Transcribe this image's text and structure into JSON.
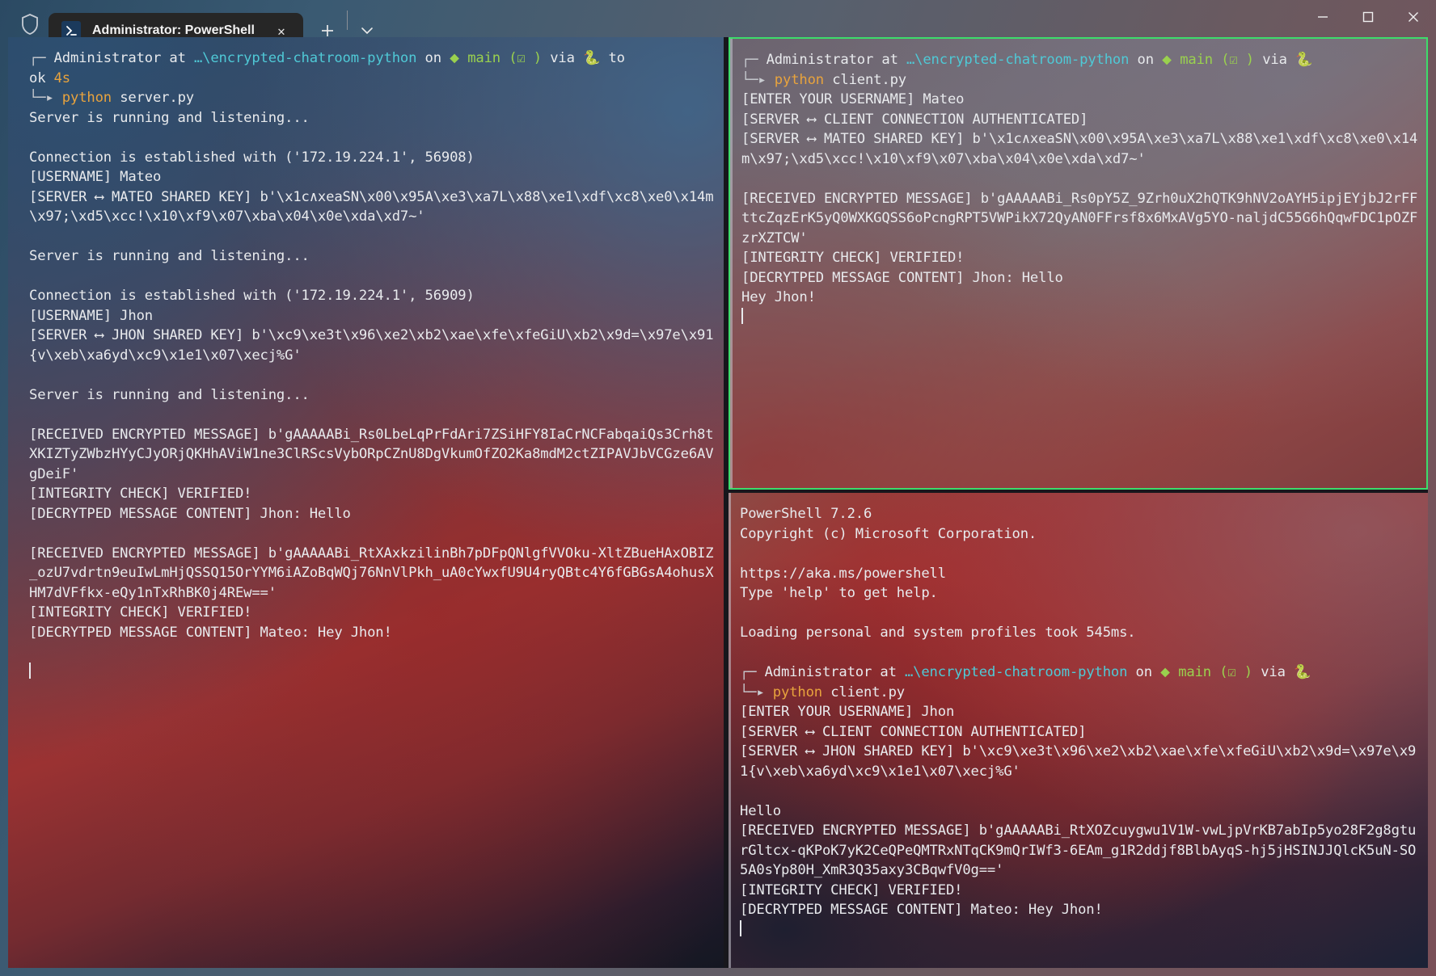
{
  "window": {
    "title": "Administrator: PowerShell",
    "controls": {
      "minimize": "─",
      "maximize": "□",
      "close": "✕"
    },
    "tab_close": "✕",
    "new_tab": "+",
    "dropdown": "⌄",
    "shield_icon": "shield-icon",
    "tab_icon_glyph": "〉_"
  },
  "colors": {
    "accent_green": "#3ddc6b",
    "prompt_cyan": "#4fc9d6",
    "branch_green": "#9ad14e",
    "cmd_yellow": "#e8a33d",
    "text": "#e8eaed"
  },
  "prompt": {
    "user": "Administrator",
    "at": "at",
    "path": "…\\encrypted-chatroom-python",
    "on": "on",
    "git_icon": "⬥",
    "branch": "main",
    "git_status": "(☑ )",
    "via": "via",
    "python_icon": "🐍",
    "took": "to",
    "ok": "ok",
    "duration": "4s",
    "arrow": "└─▸",
    "corner": "┌─"
  },
  "panes": {
    "left": {
      "name": "server-pane",
      "command_runner": "python",
      "command_arg": "server.py",
      "lines": [
        "Server is running and listening...",
        "",
        "Connection is established with ('172.19.224.1', 56908)",
        "[USERNAME] Mateo",
        "[SERVER ⟷ MATEO SHARED KEY] b'\\x1c∧xeaSN\\x00\\x95A\\xe3\\xa7L\\x88\\xe1\\xdf\\xc8\\xe0\\x14m\\x97;\\xd5\\xcc!\\x10\\xf9\\x07\\xba\\x04\\x0e\\xda\\xd7~'",
        "",
        "Server is running and listening...",
        "",
        "Connection is established with ('172.19.224.1', 56909)",
        "[USERNAME] Jhon",
        "[SERVER ⟷ JHON SHARED KEY] b'\\xc9\\xe3t\\x96\\xe2\\xb2\\xae\\xfe\\xfeGiU\\xb2\\x9d=\\x97e\\x91{v\\xeb\\xa6yd\\xc9\\x1e1\\x07\\xecj%G'",
        "",
        "Server is running and listening...",
        "",
        "[RECEIVED ENCRYPTED MESSAGE] b'gAAAAABi_Rs0LbeLqPrFdAri7ZSiHFY8IaCrNCFabqaiQs3Crh8tXKIZTyZWbzHYyCJyORjQKHhAViW1ne3ClRScsVybORpCZnU8DgVkumOfZO2Ka8mdM2ctZIPAVJbVCGze6AVgDeiF'",
        "[INTEGRITY CHECK] VERIFIED!",
        "[DECRYTPED MESSAGE CONTENT] Jhon: Hello",
        "",
        "[RECEIVED ENCRYPTED MESSAGE] b'gAAAAABi_RtXAxkzilinBh7pDFpQNlgfVVOku-XltZBueHAxOBIZ_ozU7vdrtn9euIwLmHjQSSQ15OrYYM6iAZoBqWQj76NnVlPkh_uA0cYwxfU9U4ryQBtc4Y6fGBGsA4ohusXHM7dVFfkx-eQy1nTxRhBK0j4REw=='",
        "[INTEGRITY CHECK] VERIFIED!",
        "[DECRYTPED MESSAGE CONTENT] Mateo: Hey Jhon!"
      ]
    },
    "right_top": {
      "name": "client-mateo-pane",
      "focused": true,
      "command_runner": "python",
      "command_arg": "client.py",
      "lines": [
        "[ENTER YOUR USERNAME] Mateo",
        "[SERVER ⟷ CLIENT CONNECTION AUTHENTICATED]",
        "[SERVER ⟷ MATEO SHARED KEY] b'\\x1c∧xeaSN\\x00\\x95A\\xe3\\xa7L\\x88\\xe1\\xdf\\xc8\\xe0\\x14m\\x97;\\xd5\\xcc!\\x10\\xf9\\x07\\xba\\x04\\x0e\\xda\\xd7~'",
        "",
        "[RECEIVED ENCRYPTED MESSAGE] b'gAAAAABi_Rs0pY5Z_9Zrh0uX2hQTK9hNV2oAYH5ipjEYjbJ2rFFttcZqzErK5yQ0WXKGQSS6oPcngRPT5VWPikX72QyAN0FFrsf8x6MxAVg5YO-naljdC55G6hQqwFDC1pOZFzrXZTCW'",
        "[INTEGRITY CHECK] VERIFIED!",
        "[DECRYTPED MESSAGE CONTENT] Jhon: Hello",
        "Hey Jhon!"
      ]
    },
    "right_bottom": {
      "name": "client-jhon-pane",
      "header": [
        "PowerShell 7.2.6",
        "Copyright (c) Microsoft Corporation.",
        "",
        "https://aka.ms/powershell",
        "Type 'help' to get help.",
        "",
        "Loading personal and system profiles took 545ms."
      ],
      "command_runner": "python",
      "command_arg": "client.py",
      "lines": [
        "[ENTER YOUR USERNAME] Jhon",
        "[SERVER ⟷ CLIENT CONNECTION AUTHENTICATED]",
        "[SERVER ⟷ JHON SHARED KEY] b'\\xc9\\xe3t\\x96\\xe2\\xb2\\xae\\xfe\\xfeGiU\\xb2\\x9d=\\x97e\\x91{v\\xeb\\xa6yd\\xc9\\x1e1\\x07\\xecj%G'",
        "",
        "Hello",
        "[RECEIVED ENCRYPTED MESSAGE] b'gAAAAABi_RtXOZcuygwu1V1W-vwLjpVrKB7abIp5yo28F2g8gturGltcx-qKPoK7yK2CeQPeQMTRxNTqCK9mQrIWf3-6EAm_g1R2ddjf8BlbAyqS-hj5jHSINJJQlcK5uN-SO5A0sYp80H_XmR3Q35axy3CBqwfV0g=='",
        "[INTEGRITY CHECK] VERIFIED!",
        "[DECRYTPED MESSAGE CONTENT] Mateo: Hey Jhon!"
      ]
    }
  }
}
